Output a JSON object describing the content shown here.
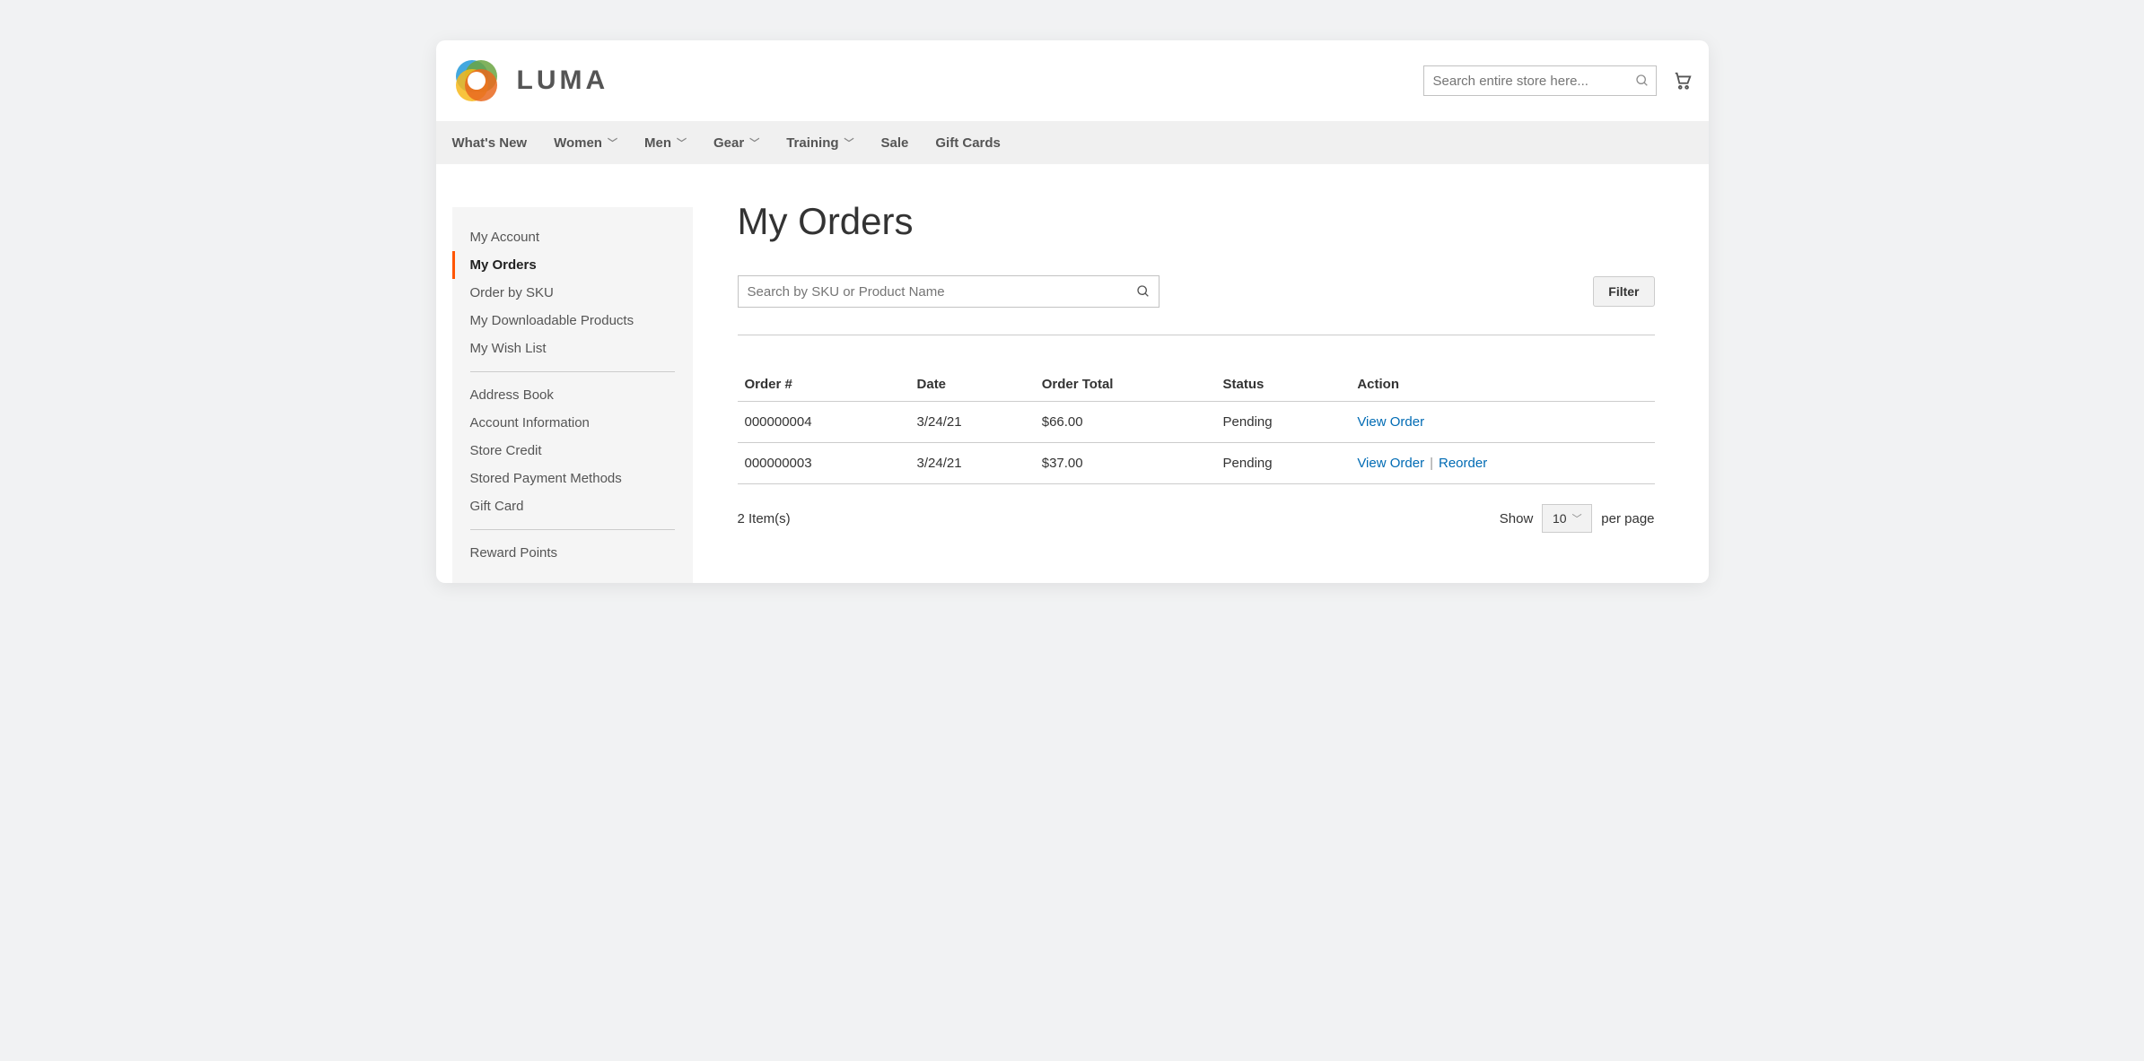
{
  "brand": {
    "name": "LUMA"
  },
  "header": {
    "search_placeholder": "Search entire store here..."
  },
  "nav": {
    "items": [
      {
        "label": "What's New",
        "has_menu": false
      },
      {
        "label": "Women",
        "has_menu": true
      },
      {
        "label": "Men",
        "has_menu": true
      },
      {
        "label": "Gear",
        "has_menu": true
      },
      {
        "label": "Training",
        "has_menu": true
      },
      {
        "label": "Sale",
        "has_menu": false
      },
      {
        "label": "Gift Cards",
        "has_menu": false
      }
    ]
  },
  "sidebar": {
    "groups": [
      [
        "My Account",
        "My Orders",
        "Order by SKU",
        "My Downloadable Products",
        "My Wish List"
      ],
      [
        "Address Book",
        "Account Information",
        "Store Credit",
        "Stored Payment Methods",
        "Gift Card"
      ],
      [
        "Reward Points"
      ]
    ],
    "active": "My Orders"
  },
  "main": {
    "title": "My Orders",
    "sku_search_placeholder": "Search by SKU or Product Name",
    "filter_button": "Filter",
    "table": {
      "columns": [
        "Order #",
        "Date",
        "Order Total",
        "Status",
        "Action"
      ],
      "rows": [
        {
          "order": "000000004",
          "date": "3/24/21",
          "total": "$66.00",
          "status": "Pending",
          "actions": [
            "View Order"
          ]
        },
        {
          "order": "000000003",
          "date": "3/24/21",
          "total": "$37.00",
          "status": "Pending",
          "actions": [
            "View Order",
            "Reorder"
          ]
        }
      ]
    },
    "paging": {
      "count_label": "2 Item(s)",
      "show_label": "Show",
      "per_page_label": "per page",
      "page_size": "10"
    }
  }
}
